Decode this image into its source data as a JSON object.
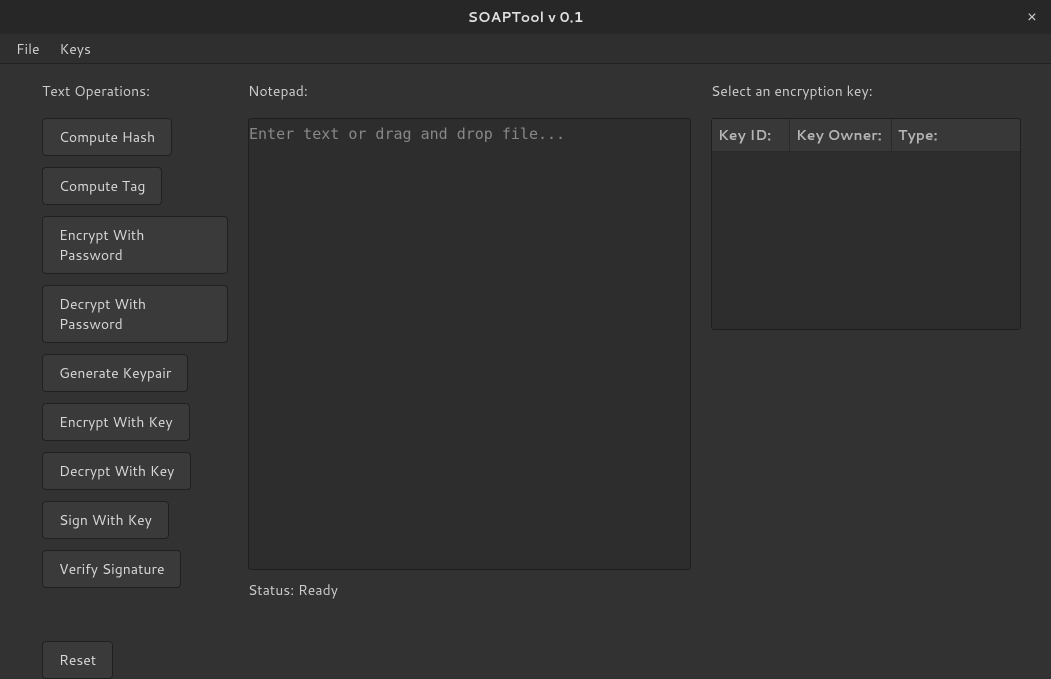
{
  "window": {
    "title": "SOAPTool v 0.1",
    "close_label": "×"
  },
  "menubar": {
    "file": "File",
    "keys": "Keys"
  },
  "left": {
    "heading": "Text Operations:",
    "buttons": {
      "compute_hash": "Compute Hash",
      "compute_tag": "Compute Tag",
      "encrypt_password": "Encrypt With Password",
      "decrypt_password": "Decrypt With Password",
      "generate_keypair": "Generate Keypair",
      "encrypt_key": "Encrypt With Key",
      "decrypt_key": "Decrypt With Key",
      "sign_key": "Sign With Key",
      "verify_signature": "Verify Signature",
      "reset": "Reset"
    }
  },
  "mid": {
    "heading": "Notepad:",
    "placeholder": "Enter text or drag and drop file...",
    "value": "",
    "status_prefix": "Status: ",
    "status_value": "Ready"
  },
  "right": {
    "heading": "Select an encryption key:",
    "columns": {
      "id": "Key ID:",
      "owner": "Key Owner:",
      "type": "Type:"
    },
    "rows": []
  }
}
